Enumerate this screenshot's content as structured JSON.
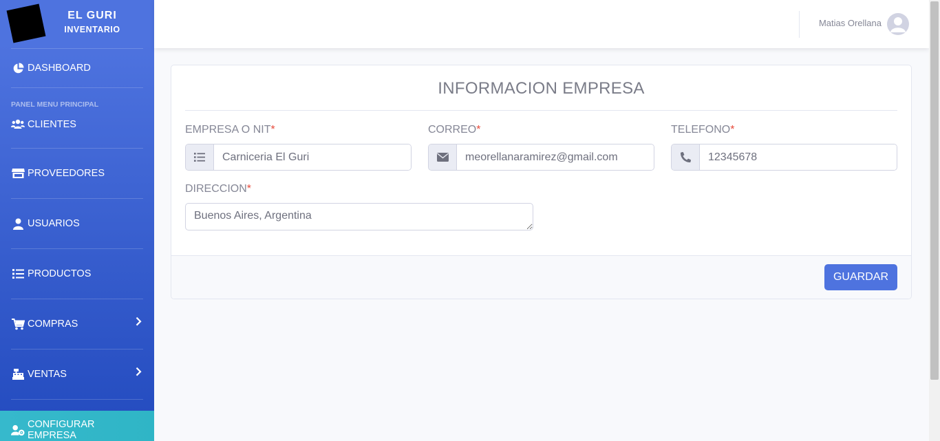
{
  "brand": {
    "title": "EL GURI",
    "subtitle": "INVENTARIO",
    "logo_icon": "black-square-logo"
  },
  "sidebar": {
    "dashboard": {
      "label": "DASHBOARD",
      "icon": "pie-chart-icon"
    },
    "heading": "PANEL MENU PRINCIPAL",
    "items": [
      {
        "label": "CLIENTES",
        "icon": "users-icon"
      },
      {
        "label": "PROVEEDORES",
        "icon": "store-icon"
      },
      {
        "label": "USUARIOS",
        "icon": "user-icon"
      },
      {
        "label": "PRODUCTOS",
        "icon": "list-icon"
      },
      {
        "label": "COMPRAS",
        "icon": "cart-icon",
        "has_submenu": true
      },
      {
        "label": "VENTAS",
        "icon": "cash-register-icon",
        "has_submenu": true
      },
      {
        "label": "CONFIGURAR EMPRESA",
        "icon": "user-gear-icon",
        "active": true
      }
    ]
  },
  "topbar": {
    "user_name": "Matias Orellana",
    "avatar_icon": "user-avatar-icon"
  },
  "form": {
    "title": "INFORMACION EMPRESA",
    "required_mark": "*",
    "empresa": {
      "label": "EMPRESA O NIT",
      "value": "Carniceria El Guri",
      "icon": "list-icon"
    },
    "correo": {
      "label": "CORREO",
      "value": "meorellanaramirez@gmail.com",
      "icon": "envelope-icon"
    },
    "telefono": {
      "label": "TELEFONO",
      "value": "12345678",
      "icon": "phone-icon"
    },
    "direccion": {
      "label": "DIRECCION",
      "value": "Buenos Aires, Argentina"
    },
    "save_label": "GUARDAR"
  },
  "colors": {
    "primary": "#4e73df",
    "sidebar_dark": "#224abe",
    "active": "#36b9cc",
    "danger": "#e74a3b"
  }
}
